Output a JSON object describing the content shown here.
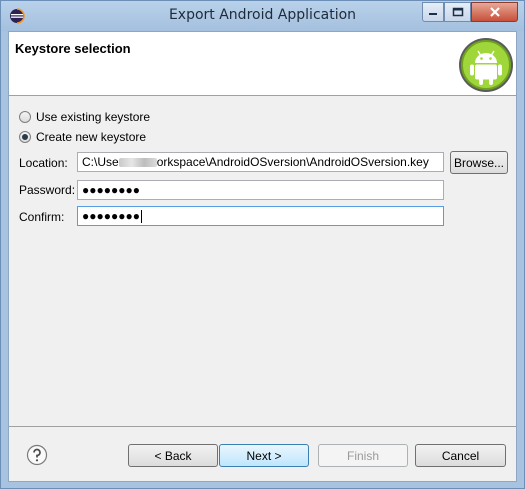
{
  "window": {
    "title": "Export Android Application",
    "min_label": "–",
    "max_label": "□",
    "close_label": "✕"
  },
  "banner": {
    "title": "Keystore selection",
    "logo_icon": "android-robot-icon"
  },
  "options": {
    "use_existing": "Use existing keystore",
    "create_new": "Create new keystore",
    "selected": "create_new"
  },
  "form": {
    "location_label": "Location:",
    "location_prefix": "C:\\Use",
    "location_suffix": "orkspace\\AndroidOSversion\\AndroidOSversion.key",
    "browse_label": "Browse...",
    "password_label": "Password:",
    "password_value": "●●●●●●●●",
    "confirm_label": "Confirm:",
    "confirm_value": "●●●●●●●●"
  },
  "footer": {
    "help_icon": "help-icon",
    "back_label": "< Back",
    "next_label": "Next >",
    "finish_label": "Finish",
    "cancel_label": "Cancel"
  },
  "colors": {
    "title_bar": "#b9d1ea",
    "close_button": "#c7503a",
    "android_green": "#8bc34a"
  }
}
